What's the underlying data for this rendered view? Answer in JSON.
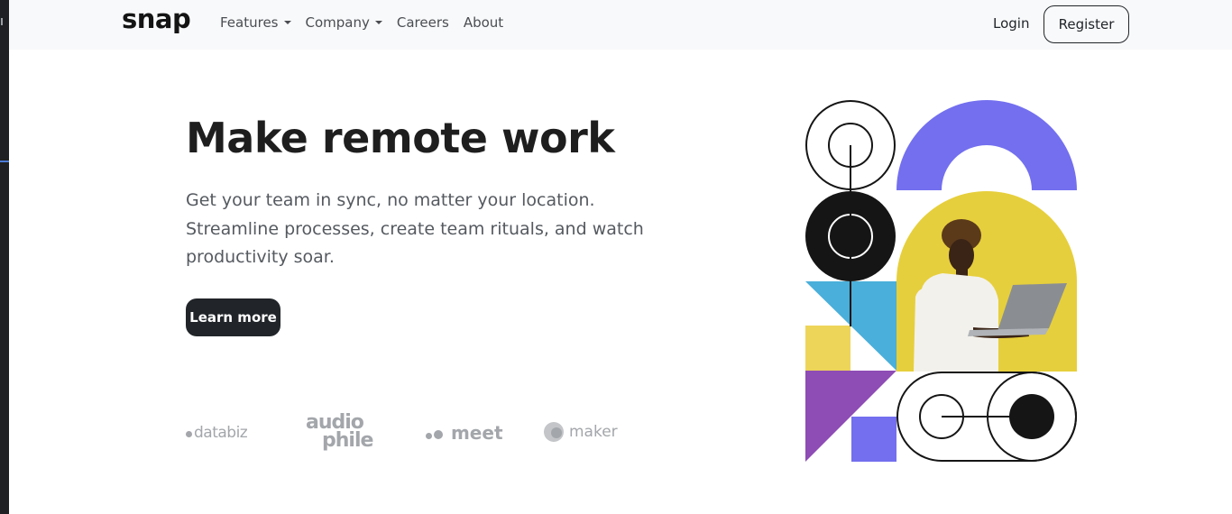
{
  "brand": {
    "name": "snap"
  },
  "nav": {
    "items": [
      {
        "label": "Features",
        "dropdown": true
      },
      {
        "label": "Company",
        "dropdown": true
      },
      {
        "label": "Careers",
        "dropdown": false
      },
      {
        "label": "About",
        "dropdown": false
      }
    ],
    "login_label": "Login",
    "register_label": "Register"
  },
  "hero": {
    "title": "Make remote work",
    "description": "Get your team in sync, no matter your location. Streamline processes, create team rituals, and watch productivity soar.",
    "cta_label": "Learn more"
  },
  "clients": {
    "databiz": "databiz",
    "audiophile_line1": "audio",
    "audiophile_line2": "phile",
    "meet": "meet",
    "maker": "maker"
  },
  "colors": {
    "purple": "#736FEF",
    "yellow": "#E6CF3C",
    "blue": "#4AAFDA",
    "violet": "#8E4CB5",
    "dark": "#151515",
    "logo_gray": "#A3A6AA"
  }
}
